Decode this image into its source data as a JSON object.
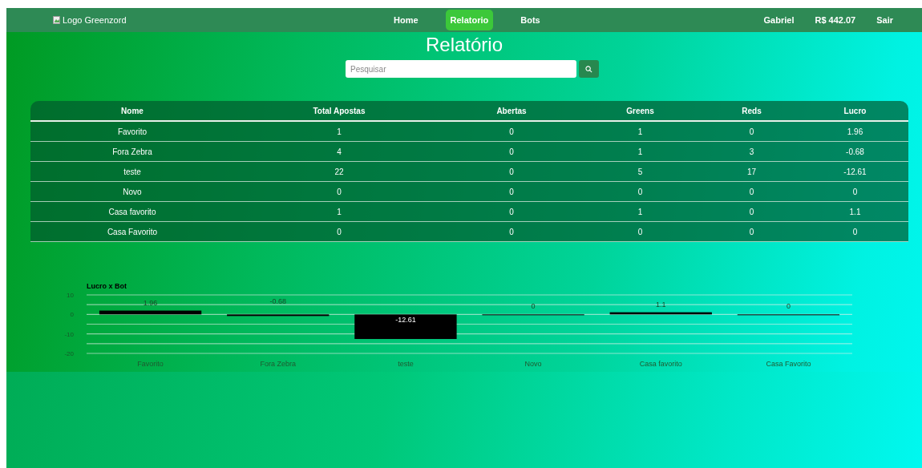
{
  "navbar": {
    "logo_alt": "Logo Greenzord",
    "links": [
      {
        "label": "Home",
        "selected": false
      },
      {
        "label": "Relatorio",
        "selected": true
      },
      {
        "label": "Bots",
        "selected": false
      }
    ],
    "user": "Gabriel",
    "balance": "R$ 442.07",
    "logout": "Sair"
  },
  "title": "Relatório",
  "search": {
    "placeholder": "Pesquisar"
  },
  "table": {
    "columns": [
      "Nome",
      "Total Apostas",
      "Abertas",
      "Greens",
      "Reds",
      "Lucro"
    ],
    "rows": [
      [
        "Favorito",
        "1",
        "0",
        "1",
        "0",
        "1.96"
      ],
      [
        "Fora Zebra",
        "4",
        "0",
        "1",
        "3",
        "-0.68"
      ],
      [
        "teste",
        "22",
        "0",
        "5",
        "17",
        "-12.61"
      ],
      [
        "Novo",
        "0",
        "0",
        "0",
        "0",
        "0"
      ],
      [
        "Casa favorito",
        "1",
        "0",
        "1",
        "0",
        "1.1"
      ],
      [
        "Casa Favorito",
        "0",
        "0",
        "0",
        "0",
        "0"
      ]
    ]
  },
  "chart": {
    "chart_data": {
      "type": "bar",
      "title": "Lucro x Bot",
      "categories": [
        "Favorito",
        "Fora Zebra",
        "teste",
        "Novo",
        "Casa favorito",
        "Casa Favorito"
      ],
      "series": [
        {
          "color": "#000000",
          "values": [
            1.96,
            -0.68,
            -12.61,
            0,
            1.1,
            0
          ]
        }
      ],
      "ylim": [
        -20,
        10
      ],
      "yticks": [
        10,
        0,
        -10,
        -20
      ],
      "data_labels": true
    }
  }
}
